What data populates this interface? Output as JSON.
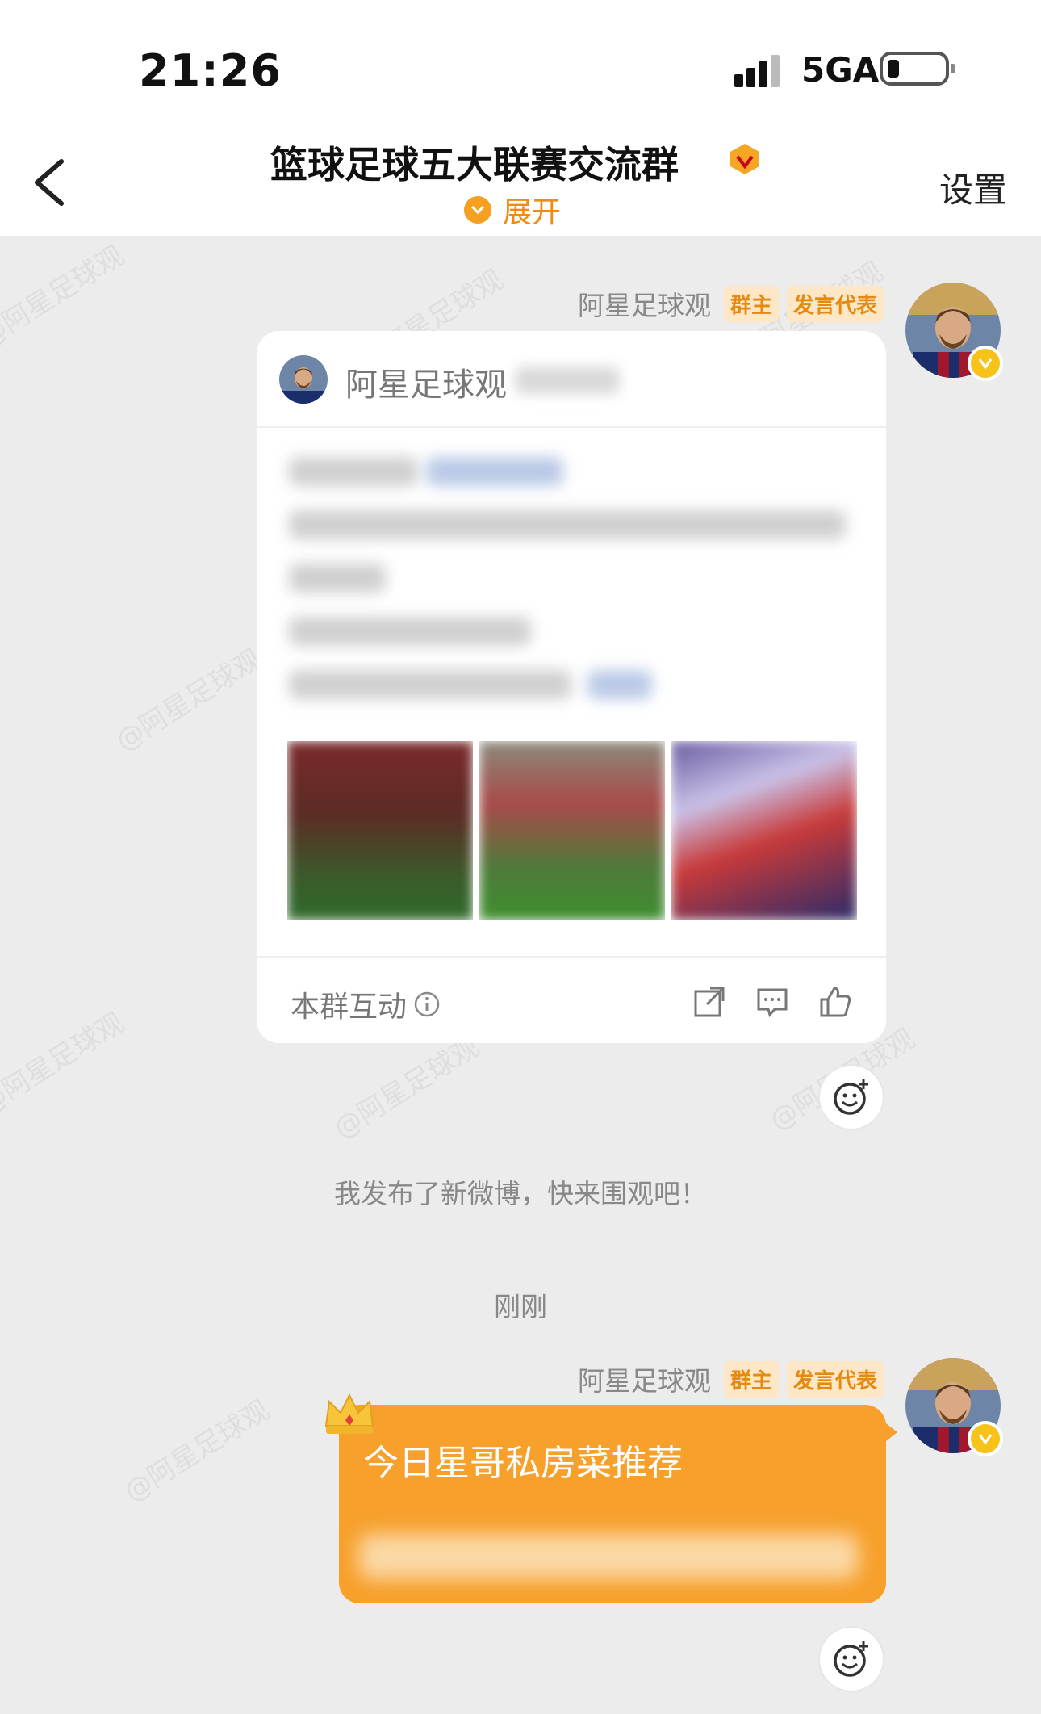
{
  "status_bar": {
    "time": "21:26",
    "network": "5GA"
  },
  "header": {
    "back_icon": "chevron-left-icon",
    "title": "篮球足球五大联赛交流群",
    "expand_label": "展开",
    "settings_label": "设置"
  },
  "watermark_text": "@阿星足球观",
  "messages": [
    {
      "sender": "阿星足球观",
      "tags": [
        "群主",
        "发言代表"
      ],
      "card": {
        "source": "阿星足球观",
        "footer_label": "本群互动",
        "icons": [
          "share-icon",
          "comment-icon",
          "like-icon"
        ]
      }
    },
    {
      "sender": "阿星足球观",
      "tags": [
        "群主",
        "发言代表"
      ],
      "text": "今日星哥私房菜推荐"
    }
  ],
  "notice_text": "我发布了新微博，快来围观吧！",
  "timestamp": "刚刚",
  "colors": {
    "accent": "#f7a02b",
    "tag_bg": "#fde7c6",
    "tag_text": "#e58a0e",
    "background": "#ececec"
  }
}
